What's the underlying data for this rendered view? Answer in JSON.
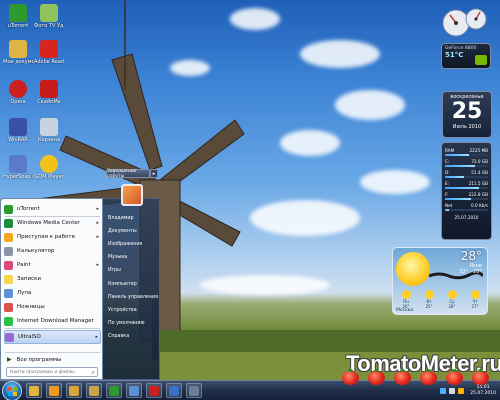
{
  "desktop_icons": [
    {
      "label": "uTorrent",
      "color": "#2e9a2e",
      "name": "utorrent-desktop-icon"
    },
    {
      "label": "Фото TV Удаляет",
      "color": "#8fc25a",
      "name": "photo-tv-desktop-icon"
    },
    {
      "label": "Мои документы",
      "color": "#e0b440",
      "name": "folder-desktop-icon"
    },
    {
      "label": "Adobe Reader 9",
      "color": "#d8231f",
      "name": "adobe-reader-desktop-icon"
    },
    {
      "label": "Opera",
      "color": "#cc1f1f",
      "name": "opera-desktop-icon"
    },
    {
      "label": "СкайпMe",
      "color": "#c81b1b",
      "name": "media-desktop-icon"
    },
    {
      "label": "WinRAR",
      "color": "#3a4fa8",
      "name": "winrar-desktop-icon"
    },
    {
      "label": "Корзина",
      "color": "#c9d3df",
      "name": "recycle-bin-desktop-icon"
    },
    {
      "label": "HyperSnap 6",
      "color": "#5a7cc8",
      "name": "hypersnap-desktop-icon"
    },
    {
      "label": "GOM Player",
      "color": "#f0c21a",
      "name": "gom-player-desktop-icon"
    }
  ],
  "start_menu": {
    "programs": [
      {
        "label": "uTorrent",
        "color": "#2e9a2e",
        "arrow": "▸"
      },
      {
        "label": "Windows Media Center",
        "color": "#1e8b3a",
        "arrow": "▸"
      },
      {
        "label": "Приступая к работе",
        "color": "#f5a623",
        "arrow": "▸"
      },
      {
        "label": "Калькулятор",
        "color": "#8a96a8",
        "arrow": ""
      },
      {
        "label": "Paint",
        "color": "#e04a7a",
        "arrow": "▸"
      },
      {
        "label": "Записки",
        "color": "#f6d64a",
        "arrow": ""
      },
      {
        "label": "Лупа",
        "color": "#5b8fd6",
        "arrow": ""
      },
      {
        "label": "Ножницы",
        "color": "#d9534f",
        "arrow": ""
      },
      {
        "label": "Internet Download Manager",
        "color": "#2bbf4a",
        "arrow": ""
      },
      {
        "label": "UltraISO",
        "color": "#9a6bd6",
        "arrow": "▸"
      }
    ],
    "all_programs": "Все программы",
    "search_placeholder": "Найти программы и файлы",
    "right_items": [
      "Владимир",
      "Документы",
      "Изображения",
      "Музыка",
      "Игры",
      "Компьютер",
      "Панель управления",
      "Устройства",
      "По умолчанию",
      "Справка"
    ],
    "shutdown_label": "Завершение работы"
  },
  "gadgets": {
    "gpu": {
      "title": "GeForce 8800",
      "temp": "51°C"
    },
    "calendar": {
      "weekday": "воскресенье",
      "day": "25",
      "month": "Июль 2010"
    },
    "system": {
      "rows": [
        {
          "label": "RAM",
          "value": "2225 MB",
          "level": 0.55
        },
        {
          "label": "C:",
          "value": "72.0 GB",
          "level": 0.7
        },
        {
          "label": "D:",
          "value": "51.4 GB",
          "level": 0.45
        },
        {
          "label": "E:",
          "value": "211.5 GB",
          "level": 0.8
        },
        {
          "label": "F:",
          "value": "222.8 GB",
          "level": 0.6
        },
        {
          "label": "Net",
          "value": "0.0 Kb/s",
          "level": 0.1
        }
      ],
      "footer": "25.07.2010"
    },
    "weather": {
      "temp": "28°",
      "summary": "Ясно",
      "range": "32° - 20°",
      "city": "Москва",
      "forecast": [
        {
          "label": "Пн",
          "temp": "26°"
        },
        {
          "label": "Вт",
          "temp": "25°"
        },
        {
          "label": "Ср",
          "temp": "28°"
        },
        {
          "label": "Чт",
          "temp": "27°"
        }
      ]
    }
  },
  "taskbar": {
    "pinned": [
      {
        "name": "explorer-taskbar-icon",
        "color": "#e0b440"
      },
      {
        "name": "media-player-taskbar-icon",
        "color": "#f29a1f"
      },
      {
        "name": "folder-taskbar-icon",
        "color": "#d7a53a"
      },
      {
        "name": "explorer2-taskbar-icon",
        "color": "#c9a44a"
      },
      {
        "name": "utorrent-taskbar-icon",
        "color": "#2e9a2e"
      },
      {
        "name": "settings-taskbar-icon",
        "color": "#5b8fd6"
      },
      {
        "name": "opera-taskbar-icon",
        "color": "#cc1f1f"
      },
      {
        "name": "app-taskbar-icon",
        "color": "#3a70c8"
      },
      {
        "name": "player-taskbar-icon",
        "color": "#6a7f9e"
      }
    ],
    "clock_time": "15:01",
    "clock_date": "25.07.2010"
  },
  "watermark": "TomatoMeter.ru"
}
